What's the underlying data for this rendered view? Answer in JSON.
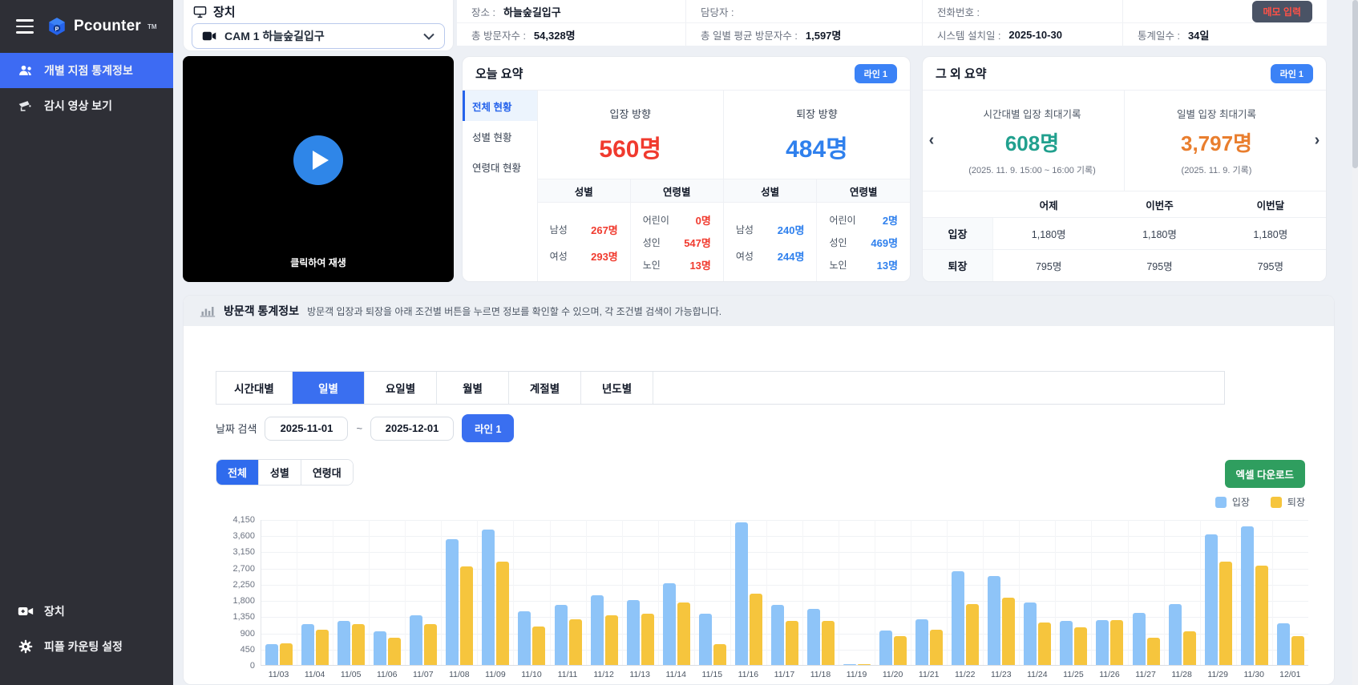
{
  "sidebar": {
    "logo": "Pcounter",
    "logo_tm": "TM",
    "items": [
      {
        "icon": "people-icon",
        "label": "개별 지점 통계정보",
        "active": true
      },
      {
        "icon": "cctv-icon",
        "label": "감시 영상 보기",
        "active": false
      }
    ],
    "bottom_items": [
      {
        "icon": "videocam-icon",
        "label": "장치"
      },
      {
        "icon": "gear-icon",
        "label": "피플 카운팅 설정"
      }
    ]
  },
  "device_panel": {
    "title": "장치",
    "camera_select": "CAM 1 하늘숲길입구"
  },
  "video": {
    "play_hint": "클릭하여 재생"
  },
  "info_bar": {
    "place_label": "장소 :",
    "place_value": "하늘숲길입구",
    "manager_label": "담당자 :",
    "manager_value": "",
    "phone_label": "전화번호 :",
    "phone_value": "",
    "memo_button": "메모 입력",
    "total_label": "총 방문자수 :",
    "total_value": "54,328명",
    "avg_label": "총 일별 평균 방문자수 :",
    "avg_value": "1,597명",
    "install_label": "시스템 설치일 :",
    "install_value": "2025-10-30",
    "days_label": "통계일수 :",
    "days_value": "34일"
  },
  "today_summary": {
    "title": "오늘 요약",
    "badge": "라인 1",
    "tabs": [
      {
        "label": "전체 현황",
        "active": true
      },
      {
        "label": "성별 현황",
        "active": false
      },
      {
        "label": "연령대 현황",
        "active": false
      }
    ],
    "enter": {
      "direction_label": "입장 방향",
      "total": "560명",
      "gender_header": "성별",
      "age_header": "연령별",
      "gender": [
        {
          "label": "남성",
          "value": "267명"
        },
        {
          "label": "여성",
          "value": "293명"
        }
      ],
      "age": [
        {
          "label": "어린이",
          "value": "0명"
        },
        {
          "label": "성인",
          "value": "547명"
        },
        {
          "label": "노인",
          "value": "13명"
        }
      ]
    },
    "exit": {
      "direction_label": "퇴장 방향",
      "total": "484명",
      "gender_header": "성별",
      "age_header": "연령별",
      "gender": [
        {
          "label": "남성",
          "value": "240명"
        },
        {
          "label": "여성",
          "value": "244명"
        }
      ],
      "age": [
        {
          "label": "어린이",
          "value": "2명"
        },
        {
          "label": "성인",
          "value": "469명"
        },
        {
          "label": "노인",
          "value": "13명"
        }
      ]
    }
  },
  "other_summary": {
    "title": "그 외 요약",
    "badge": "라인 1",
    "stats": [
      {
        "label": "시간대별 입장 최대기록",
        "value": "608명",
        "sub": "(2025. 11. 9. 15:00 ~ 16:00 기록)",
        "color": "#21a08e"
      },
      {
        "label": "일별 입장 최대기록",
        "value": "3,797명",
        "sub": "(2025. 11. 9. 기록)",
        "color": "#e97e2e"
      }
    ],
    "table": {
      "headers": [
        "어제",
        "이번주",
        "이번달"
      ],
      "rows": [
        {
          "label": "입장",
          "values": [
            "1,180명",
            "1,180명",
            "1,180명"
          ]
        },
        {
          "label": "퇴장",
          "values": [
            "795명",
            "795명",
            "795명"
          ]
        }
      ]
    }
  },
  "stats_section": {
    "title": "방문객 통계정보",
    "description": "방문객 입장과 퇴장을 아래 조건별 버튼을 누르면 정보를 확인할 수 있으며, 각 조건별 검색이 가능합니다.",
    "tabs": [
      {
        "label": "시간대별",
        "active": false
      },
      {
        "label": "일별",
        "active": true
      },
      {
        "label": "요일별",
        "active": false
      },
      {
        "label": "월별",
        "active": false
      },
      {
        "label": "계절별",
        "active": false
      },
      {
        "label": "년도별",
        "active": false
      }
    ],
    "date_search_label": "날짜 검색",
    "date_from": "2025-11-01",
    "date_tilde": "~",
    "date_to": "2025-12-01",
    "line_button": "라인 1",
    "filters": [
      {
        "label": "전체",
        "active": true
      },
      {
        "label": "성별",
        "active": false
      },
      {
        "label": "연령대",
        "active": false
      }
    ],
    "excel_button": "엑셀 다운로드"
  },
  "chart_data": {
    "type": "bar",
    "title": "",
    "xlabel": "",
    "ylabel": "",
    "categories": [
      "11/03",
      "11/04",
      "11/05",
      "11/06",
      "11/07",
      "11/08",
      "11/09",
      "11/10",
      "11/11",
      "11/12",
      "11/13",
      "11/14",
      "11/15",
      "11/16",
      "11/17",
      "11/18",
      "11/19",
      "11/20",
      "11/21",
      "11/22",
      "11/23",
      "11/24",
      "11/25",
      "11/26",
      "11/27",
      "11/28",
      "11/29",
      "11/30",
      "12/01"
    ],
    "series": [
      {
        "name": "입장",
        "color": "#8ec4f8",
        "values": [
          580,
          1130,
          1220,
          945,
          1380,
          3500,
          3797,
          1500,
          1680,
          1930,
          1800,
          2260,
          1430,
          4040,
          1680,
          1560,
          20,
          950,
          1270,
          2600,
          2470,
          1730,
          1220,
          1240,
          1450,
          1700,
          3640,
          3900,
          1150
        ]
      },
      {
        "name": "퇴장",
        "color": "#f6c53d",
        "values": [
          610,
          970,
          1130,
          760,
          1130,
          2740,
          2870,
          1080,
          1270,
          1380,
          1430,
          1730,
          575,
          1980,
          1220,
          1220,
          20,
          800,
          970,
          1700,
          1870,
          1180,
          1040,
          1240,
          760,
          945,
          2880,
          2770,
          805
        ]
      }
    ],
    "y_ticks": [
      "4,150",
      "3,600",
      "3,150",
      "2,700",
      "2,250",
      "1,800",
      "1,350",
      "900",
      "450",
      "0"
    ],
    "ylim": [
      0,
      4150
    ],
    "grid": true,
    "legend_position": "top-right"
  }
}
